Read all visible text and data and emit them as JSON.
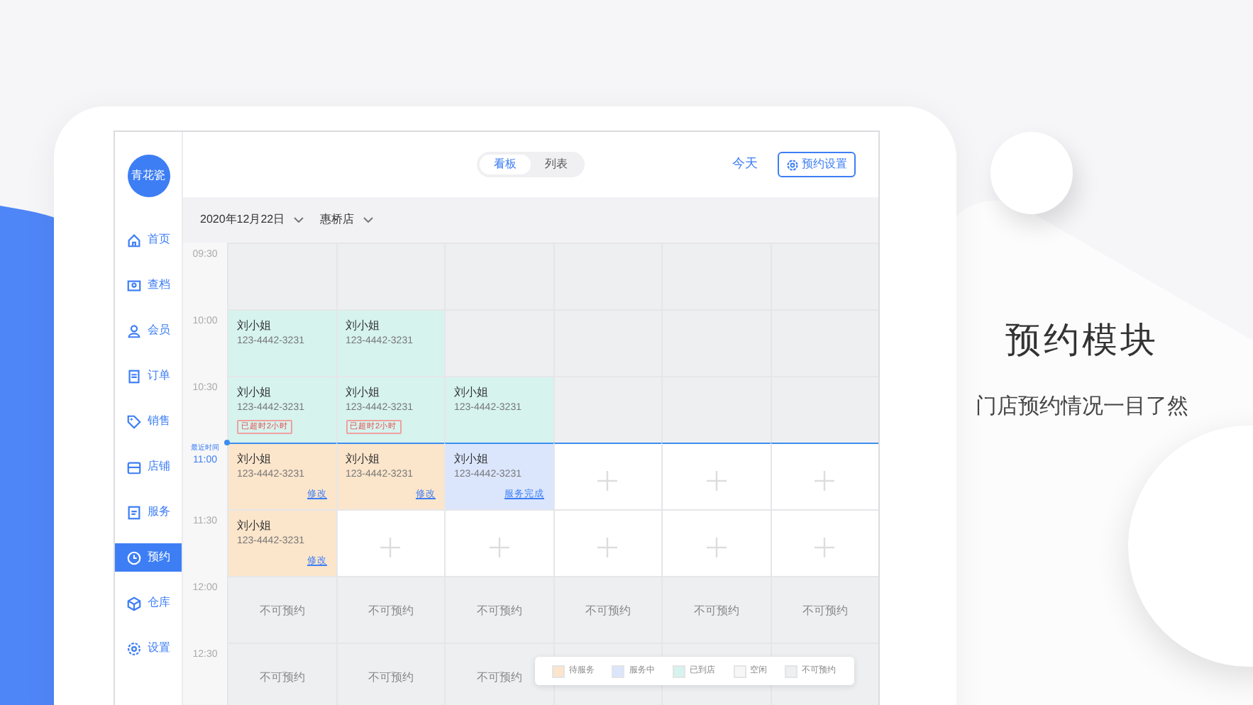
{
  "sidebar": {
    "logo": "青花瓷",
    "items": [
      {
        "label": "首页",
        "selected": false
      },
      {
        "label": "查档",
        "selected": false
      },
      {
        "label": "会员",
        "selected": false
      },
      {
        "label": "订单",
        "selected": false
      },
      {
        "label": "销售",
        "selected": false
      },
      {
        "label": "店铺",
        "selected": false
      },
      {
        "label": "服务",
        "selected": false
      },
      {
        "label": "预约",
        "selected": true
      },
      {
        "label": "仓库",
        "selected": false
      },
      {
        "label": "设置",
        "selected": false
      }
    ]
  },
  "view_toggle": [
    {
      "label": "看板",
      "selected": true
    },
    {
      "label": "列表",
      "selected": false
    }
  ],
  "today_link": "今天",
  "settings_button": "预约设置",
  "filters": [
    {
      "label": "2020年12月22日"
    },
    {
      "label": "惠桥店"
    }
  ],
  "schedule": {
    "rows": [
      {
        "time": "09:30",
        "current": false,
        "cells": [
          {
            "kind": "closed"
          },
          {
            "kind": "closed"
          },
          {
            "kind": "closed"
          },
          {
            "kind": "closed"
          },
          {
            "kind": "closed"
          },
          {
            "kind": "closed"
          }
        ]
      },
      {
        "time": "10:00",
        "current": false,
        "cells": [
          {
            "kind": "arrived",
            "name": "刘小姐",
            "phone": "123-4442-3231"
          },
          {
            "kind": "arrived",
            "name": "刘小姐",
            "phone": "123-4442-3231"
          },
          {
            "kind": "closed"
          },
          {
            "kind": "closed"
          },
          {
            "kind": "closed"
          },
          {
            "kind": "closed"
          }
        ]
      },
      {
        "time": "10:30",
        "current": false,
        "cells": [
          {
            "kind": "arrived",
            "name": "刘小姐",
            "phone": "123-4442-3231",
            "tag": "已超时2小时"
          },
          {
            "kind": "arrived",
            "name": "刘小姐",
            "phone": "123-4442-3231",
            "tag": "已超时2小时"
          },
          {
            "kind": "arrived",
            "name": "刘小姐",
            "phone": "123-4442-3231"
          },
          {
            "kind": "closed"
          },
          {
            "kind": "closed"
          },
          {
            "kind": "closed"
          }
        ]
      },
      {
        "time": "11:00",
        "note": "最近时间",
        "current": true,
        "cells": [
          {
            "kind": "pending",
            "name": "刘小姐",
            "phone": "123-4442-3231",
            "action": "修改"
          },
          {
            "kind": "pending",
            "name": "刘小姐",
            "phone": "123-4442-3231",
            "action": "修改"
          },
          {
            "kind": "serving",
            "name": "刘小姐",
            "phone": "123-4442-3231",
            "action": "服务完成"
          },
          {
            "kind": "free"
          },
          {
            "kind": "free"
          },
          {
            "kind": "free"
          }
        ]
      },
      {
        "time": "11:30",
        "current": false,
        "cells": [
          {
            "kind": "pending",
            "name": "刘小姐",
            "phone": "123-4442-3231",
            "action": "修改"
          },
          {
            "kind": "free"
          },
          {
            "kind": "free"
          },
          {
            "kind": "free"
          },
          {
            "kind": "free"
          },
          {
            "kind": "free"
          }
        ]
      },
      {
        "time": "12:00",
        "current": false,
        "cells": [
          {
            "kind": "blocked",
            "label": "不可预约"
          },
          {
            "kind": "blocked",
            "label": "不可预约"
          },
          {
            "kind": "blocked",
            "label": "不可预约"
          },
          {
            "kind": "blocked",
            "label": "不可预约"
          },
          {
            "kind": "blocked",
            "label": "不可预约"
          },
          {
            "kind": "blocked",
            "label": "不可预约"
          }
        ]
      },
      {
        "time": "12:30",
        "current": false,
        "cells": [
          {
            "kind": "blocked",
            "label": "不可预约"
          },
          {
            "kind": "blocked",
            "label": "不可预约"
          },
          {
            "kind": "blocked",
            "label": "不可预约"
          },
          {
            "kind": "blocked"
          },
          {
            "kind": "blocked"
          },
          {
            "kind": "blocked"
          }
        ]
      }
    ]
  },
  "legend": [
    {
      "label": "待服务",
      "color": "#fbe5cb"
    },
    {
      "label": "服务中",
      "color": "#dbe6fd"
    },
    {
      "label": "已到店",
      "color": "#d6f3ee"
    },
    {
      "label": "空闲",
      "color": "#f7f7f7"
    },
    {
      "label": "不可预约",
      "color": "#eeeff1"
    }
  ],
  "promo": {
    "title": "预约模块",
    "subtitle": "门店预约情况一目了然"
  }
}
